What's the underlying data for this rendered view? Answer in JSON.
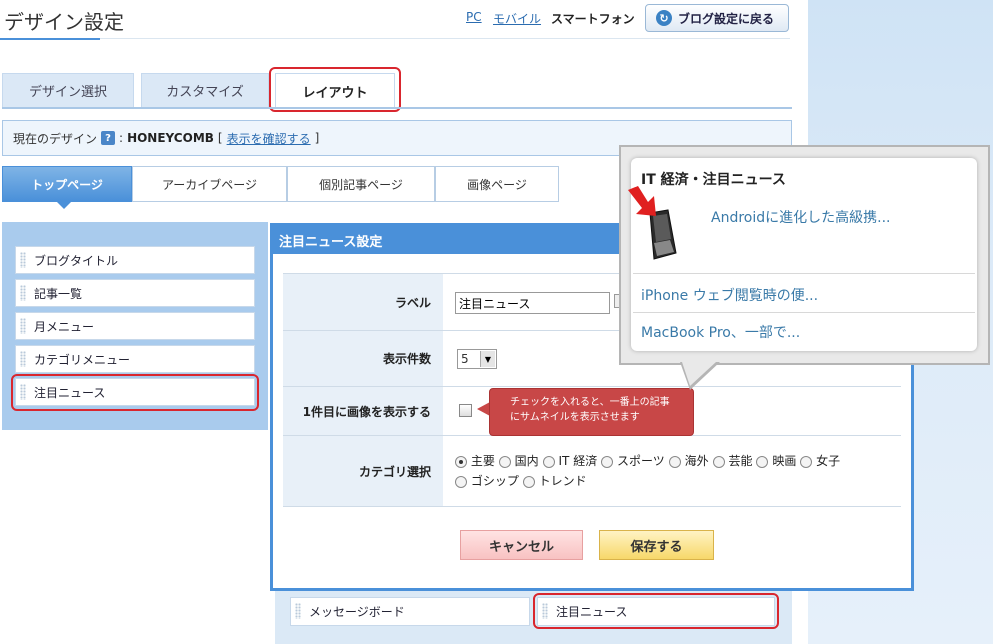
{
  "page_title": "デザイン設定",
  "modes": {
    "pc": "PC",
    "mobile": "モバイル",
    "smartphone": "スマートフォン"
  },
  "back_button": "ブログ設定に戻る",
  "tabs": [
    {
      "label": "デザイン選択"
    },
    {
      "label": "カスタマイズ"
    },
    {
      "label": "レイアウト"
    }
  ],
  "design_bar": {
    "prefix": "現在のデザイン",
    "help": "?",
    "sep": ":",
    "name": "HONEYCOMB",
    "bracket_open": "[",
    "confirm_link": "表示を確認する",
    "bracket_close": "]"
  },
  "subtabs": [
    {
      "label": "トップページ"
    },
    {
      "label": "アーカイブページ"
    },
    {
      "label": "個別記事ページ"
    },
    {
      "label": "画像ページ"
    }
  ],
  "sidebar_items": [
    {
      "label": "ブログタイトル"
    },
    {
      "label": "記事一覧"
    },
    {
      "label": "月メニュー"
    },
    {
      "label": "カテゴリメニュー"
    },
    {
      "label": "注目ニュース"
    }
  ],
  "dialog": {
    "title": "注目ニュース設定",
    "label_label": "ラベル",
    "label_value": "注目ニュース",
    "count_label": "表示件数",
    "count_value": "5",
    "count_arrow": "▼",
    "image_label": "1件目に画像を表示する",
    "category_label": "カテゴリ選択",
    "categories": [
      {
        "label": "主要",
        "checked": true
      },
      {
        "label": "国内",
        "checked": false
      },
      {
        "label": "IT 経済",
        "checked": false
      },
      {
        "label": "スポーツ",
        "checked": false
      },
      {
        "label": "海外",
        "checked": false
      },
      {
        "label": "芸能",
        "checked": false
      },
      {
        "label": "映画",
        "checked": false
      },
      {
        "label": "女子",
        "checked": false
      },
      {
        "label": "ゴシップ",
        "checked": false
      },
      {
        "label": "トレンド",
        "checked": false
      }
    ],
    "tooltip_line1": "チェックを入れると、一番上の記事",
    "tooltip_line2": "にサムネイルを表示させます",
    "cancel": "キャンセル",
    "save": "保存する"
  },
  "bottom_items": [
    {
      "label": "メッセージボード"
    },
    {
      "label": "注目ニュース"
    }
  ],
  "preview": {
    "title": "IT 経済・注目ニュース",
    "item1": "Androidに進化した高級携...",
    "item2": "iPhone ウェブ閲覧時の便...",
    "item3": "MacBook Pro、一部で..."
  }
}
